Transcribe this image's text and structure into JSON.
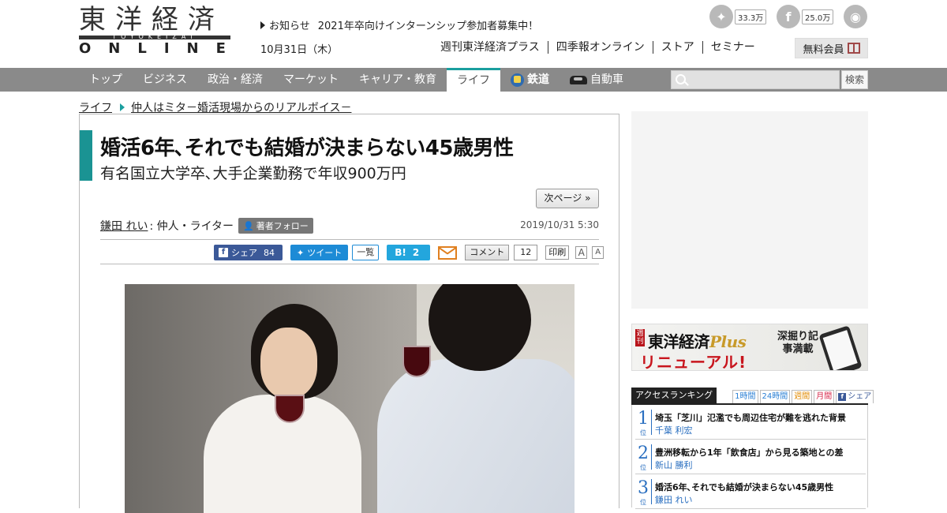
{
  "logo": {
    "kanji": "東洋経済",
    "sub": "TOYOKEIZAI",
    "online": "ONLINE"
  },
  "notice": {
    "label": "お知らせ",
    "text": "2021年卒向けインターンシップ参加者募集中！"
  },
  "date": "10月31日（木）",
  "social": {
    "twitter": {
      "icon": "twitter-icon",
      "count": "33.3万"
    },
    "facebook": {
      "icon": "facebook-icon",
      "count": "25.0万"
    },
    "rss": {
      "icon": "rss-icon"
    }
  },
  "topnav": [
    "週刊東洋経済プラス",
    "四季報オンライン",
    "ストア",
    "セミナー"
  ],
  "member_button": "無料会員",
  "gnav": [
    {
      "label": "トップ"
    },
    {
      "label": "ビジネス"
    },
    {
      "label": "政治・経済"
    },
    {
      "label": "マーケット"
    },
    {
      "label": "キャリア・教育"
    },
    {
      "label": "ライフ",
      "active": true
    },
    {
      "label": "鉄道",
      "icon": "train-icon"
    },
    {
      "label": "自動車",
      "icon": "car-icon"
    }
  ],
  "search": {
    "button": "検索",
    "placeholder": ""
  },
  "breadcrumb": {
    "category": "ライフ",
    "series": "仲人はミタ－婚活現場からのリアルボイス－"
  },
  "article": {
    "title": "婚活6年､それでも結婚が決まらない45歳男性",
    "subtitle": "有名国立大学卒､大手企業勤務で年収900万円",
    "next_page": "次ページ »",
    "author": "鎌田 れい",
    "author_role": ": 仲人・ライター",
    "follow": "著者フォロー",
    "published": "2019/10/31 5:30",
    "share": {
      "facebook_label": "シェア",
      "facebook_count": "84",
      "tweet_label": "ツイート",
      "list_label": "一覧",
      "hatena_label": "B!",
      "hatena_count": "2",
      "comment_label": "コメント",
      "comment_count": "12",
      "print_label": "印刷",
      "font_large": "A",
      "font_small": "A"
    }
  },
  "banner": {
    "weekly": "週刊",
    "title": "東洋経済",
    "plus": "Plus",
    "renewal": "リニューアル!",
    "deep": "深掘り記事満載"
  },
  "ranking": {
    "title": "アクセスランキング",
    "tabs": [
      "1時間",
      "24時間",
      "週間",
      "月間",
      "シェア"
    ],
    "items": [
      {
        "rank": "1",
        "suffix": "位",
        "title": "埼玉「芝川」氾濫でも周辺住宅が難を逃れた背景",
        "author": "千葉 利宏"
      },
      {
        "rank": "2",
        "suffix": "位",
        "title": "豊洲移転から1年「飲食店」から見る築地との差",
        "author": "新山 勝利"
      },
      {
        "rank": "3",
        "suffix": "位",
        "title": "婚活6年､それでも結婚が決まらない45歳男性",
        "author": "鎌田 れい"
      }
    ]
  }
}
